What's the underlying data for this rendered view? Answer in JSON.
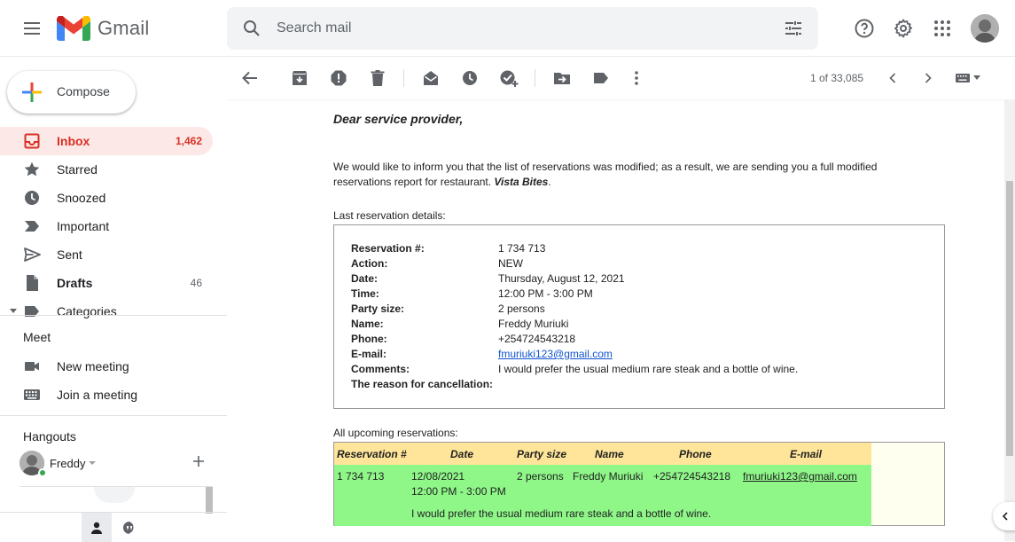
{
  "app": {
    "name": "Gmail"
  },
  "search": {
    "placeholder": "Search mail"
  },
  "compose": {
    "label": "Compose"
  },
  "nav": [
    {
      "label": "Inbox",
      "count": "1,462",
      "icon": "inbox-icon",
      "active": true
    },
    {
      "label": "Starred",
      "count": "",
      "icon": "star-icon"
    },
    {
      "label": "Snoozed",
      "count": "",
      "icon": "clock-icon"
    },
    {
      "label": "Important",
      "count": "",
      "icon": "important-icon"
    },
    {
      "label": "Sent",
      "count": "",
      "icon": "send-icon"
    },
    {
      "label": "Drafts",
      "count": "46",
      "icon": "draft-icon",
      "bold": true
    },
    {
      "label": "Categories",
      "count": "",
      "icon": "label-icon"
    }
  ],
  "meet": {
    "title": "Meet",
    "new_meeting": "New meeting",
    "join_meeting": "Join a meeting"
  },
  "hangouts": {
    "title": "Hangouts",
    "user_name": "Freddy"
  },
  "pager": {
    "text": "1 of 33,085"
  },
  "email": {
    "greeting": "Dear service provider,",
    "paragraph_text": "We would like to inform you that the list of reservations was modified; as a result, we are sending you a full modified reservations report for restaurant.",
    "restaurant": "Vista Bites",
    "last_label": "Last reservation details:",
    "details": [
      {
        "key": "Reservation #:",
        "value": "1 734 713"
      },
      {
        "key": "Action:",
        "value": "NEW"
      },
      {
        "key": "Date:",
        "value": "Thursday, August 12, 2021"
      },
      {
        "key": "Time:",
        "value": "12:00 PM - 3:00 PM"
      },
      {
        "key": "Party size:",
        "value": "2 persons"
      },
      {
        "key": "Name:",
        "value": "Freddy Muriuki"
      },
      {
        "key": "Phone:",
        "value": "+254724543218"
      },
      {
        "key": "E-mail:",
        "value": "fmuriuki123@gmail.com"
      },
      {
        "key": "Comments:",
        "value": "I would prefer the usual medium rare steak and a bottle of wine."
      },
      {
        "key": "The reason for cancellation:",
        "value": ""
      }
    ],
    "upcoming_label": "All upcoming reservations:",
    "table": {
      "headers": [
        "Reservation #",
        "Date",
        "Party size",
        "Name",
        "Phone",
        "E-mail"
      ],
      "row": {
        "reservation": "1 734 713",
        "date": "12/08/2021",
        "time": "12:00 PM - 3:00 PM",
        "party": "2 persons",
        "name": "Freddy Muriuki",
        "phone": "+254724543218",
        "email": "fmuriuki123@gmail.com",
        "comment": "I would prefer the usual medium rare steak and a bottle of wine."
      }
    }
  },
  "colors": {
    "inbox_active_bg": "#fce8e6",
    "inbox_active_text": "#d93025",
    "table_header_bg": "#ffe599",
    "table_row_bg": "#8ef788",
    "link": "#1155cc"
  }
}
